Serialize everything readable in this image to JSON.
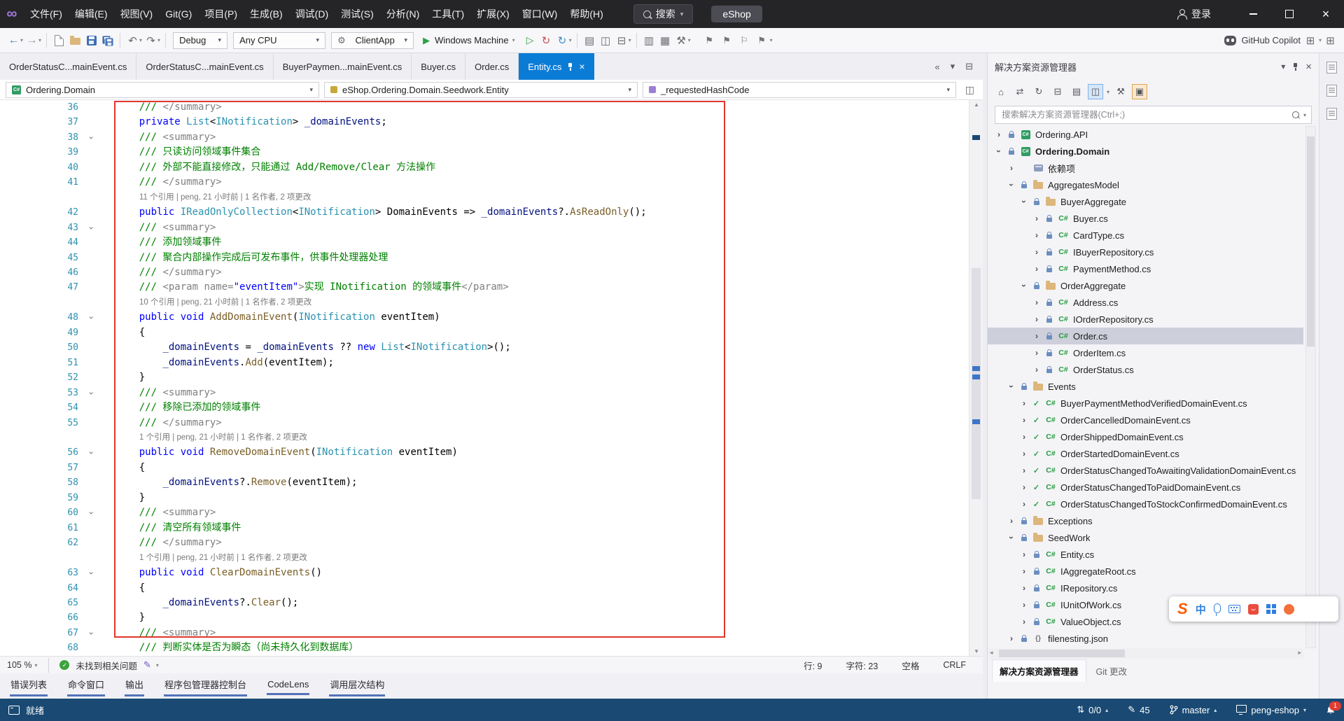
{
  "titlebar": {
    "menus": [
      "文件(F)",
      "编辑(E)",
      "视图(V)",
      "Git(G)",
      "项目(P)",
      "生成(B)",
      "调试(D)",
      "测试(S)",
      "分析(N)",
      "工具(T)",
      "扩展(X)",
      "窗口(W)",
      "帮助(H)"
    ],
    "search_label": "搜索",
    "solution_badge": "eShop",
    "signin_label": "登录"
  },
  "toolbar": {
    "debug_config": "Debug",
    "platform": "Any CPU",
    "startup_profile": "ClientApp",
    "run_target": "Windows Machine",
    "copilot_label": "GitHub Copilot"
  },
  "tabs": [
    {
      "label": "OrderStatusC...mainEvent.cs",
      "active": false
    },
    {
      "label": "OrderStatusC...mainEvent.cs",
      "active": false
    },
    {
      "label": "BuyerPaymen...mainEvent.cs",
      "active": false
    },
    {
      "label": "Buyer.cs",
      "active": false
    },
    {
      "label": "Order.cs",
      "active": false
    },
    {
      "label": "Entity.cs",
      "active": true
    }
  ],
  "navbar": {
    "project": "Ordering.Domain",
    "type": "eShop.Ordering.Domain.Seedwork.Entity",
    "member": "_requestedHashCode"
  },
  "editor": {
    "lines": [
      {
        "n": "36",
        "t": [
          [
            "p",
            "    "
          ],
          [
            "c",
            "/// "
          ],
          [
            "g",
            "</summary>"
          ]
        ]
      },
      {
        "n": "37",
        "t": [
          [
            "p",
            "    "
          ],
          [
            "k",
            "private"
          ],
          [
            "p",
            " "
          ],
          [
            "t",
            "List"
          ],
          [
            "p",
            "<"
          ],
          [
            "t",
            "INotification"
          ],
          [
            "p",
            "> "
          ],
          [
            "f",
            "_domainEvents"
          ],
          [
            "p",
            ";"
          ]
        ]
      },
      {
        "n": "38",
        "fold": true,
        "t": [
          [
            "p",
            "    "
          ],
          [
            "c",
            "/// "
          ],
          [
            "g",
            "<summary>"
          ]
        ]
      },
      {
        "n": "39",
        "t": [
          [
            "p",
            "    "
          ],
          [
            "c",
            "/// 只读访问领域事件集合"
          ]
        ]
      },
      {
        "n": "40",
        "t": [
          [
            "p",
            "    "
          ],
          [
            "c",
            "/// 外部不能直接修改，只能通过 Add/Remove/Clear 方法操作"
          ]
        ]
      },
      {
        "n": "41",
        "t": [
          [
            "p",
            "    "
          ],
          [
            "c",
            "/// "
          ],
          [
            "g",
            "</summary>"
          ]
        ]
      },
      {
        "cl": "11 个引用 | peng, 21 小时前 | 1 名作者, 2 项更改"
      },
      {
        "n": "42",
        "t": [
          [
            "p",
            "    "
          ],
          [
            "k",
            "public"
          ],
          [
            "p",
            " "
          ],
          [
            "t",
            "IReadOnlyCollection"
          ],
          [
            "p",
            "<"
          ],
          [
            "t",
            "INotification"
          ],
          [
            "p",
            "> DomainEvents => "
          ],
          [
            "f",
            "_domainEvents"
          ],
          [
            "p",
            "?."
          ],
          [
            "m",
            "AsReadOnly"
          ],
          [
            "p",
            "();"
          ]
        ]
      },
      {
        "n": "43",
        "fold": true,
        "t": [
          [
            "p",
            "    "
          ],
          [
            "c",
            "/// "
          ],
          [
            "g",
            "<summary>"
          ]
        ]
      },
      {
        "n": "44",
        "t": [
          [
            "p",
            "    "
          ],
          [
            "c",
            "/// 添加领域事件"
          ]
        ]
      },
      {
        "n": "45",
        "t": [
          [
            "p",
            "    "
          ],
          [
            "c",
            "/// 聚合内部操作完成后可发布事件，供事件处理器处理"
          ]
        ]
      },
      {
        "n": "46",
        "t": [
          [
            "p",
            "    "
          ],
          [
            "c",
            "/// "
          ],
          [
            "g",
            "</summary>"
          ]
        ]
      },
      {
        "n": "47",
        "t": [
          [
            "p",
            "    "
          ],
          [
            "c",
            "/// "
          ],
          [
            "g",
            "<param name="
          ],
          [
            "a",
            "\"eventItem\""
          ],
          [
            "g",
            ">"
          ],
          [
            "c",
            "实现 INotification 的领域事件"
          ],
          [
            "g",
            "</param>"
          ]
        ]
      },
      {
        "cl": "10 个引用 | peng, 21 小时前 | 1 名作者, 2 项更改"
      },
      {
        "n": "48",
        "fold": true,
        "t": [
          [
            "p",
            "    "
          ],
          [
            "k",
            "public"
          ],
          [
            "p",
            " "
          ],
          [
            "k",
            "void"
          ],
          [
            "p",
            " "
          ],
          [
            "m",
            "AddDomainEvent"
          ],
          [
            "p",
            "("
          ],
          [
            "t",
            "INotification"
          ],
          [
            "p",
            " eventItem)"
          ]
        ]
      },
      {
        "n": "49",
        "t": [
          [
            "p",
            "    {"
          ]
        ]
      },
      {
        "n": "50",
        "t": [
          [
            "p",
            "        "
          ],
          [
            "f",
            "_domainEvents"
          ],
          [
            "p",
            " = "
          ],
          [
            "f",
            "_domainEvents"
          ],
          [
            "p",
            " ?? "
          ],
          [
            "k",
            "new"
          ],
          [
            "p",
            " "
          ],
          [
            "t",
            "List"
          ],
          [
            "p",
            "<"
          ],
          [
            "t",
            "INotification"
          ],
          [
            "p",
            ">();"
          ]
        ]
      },
      {
        "n": "51",
        "t": [
          [
            "p",
            "        "
          ],
          [
            "f",
            "_domainEvents"
          ],
          [
            "p",
            "."
          ],
          [
            "m",
            "Add"
          ],
          [
            "p",
            "(eventItem);"
          ]
        ]
      },
      {
        "n": "52",
        "t": [
          [
            "p",
            "    }"
          ]
        ]
      },
      {
        "n": "53",
        "fold": true,
        "t": [
          [
            "p",
            "    "
          ],
          [
            "c",
            "/// "
          ],
          [
            "g",
            "<summary>"
          ]
        ]
      },
      {
        "n": "54",
        "t": [
          [
            "p",
            "    "
          ],
          [
            "c",
            "/// 移除已添加的领域事件"
          ]
        ]
      },
      {
        "n": "55",
        "t": [
          [
            "p",
            "    "
          ],
          [
            "c",
            "/// "
          ],
          [
            "g",
            "</summary>"
          ]
        ]
      },
      {
        "cl": "1 个引用 | peng, 21 小时前 | 1 名作者, 2 项更改"
      },
      {
        "n": "56",
        "fold": true,
        "t": [
          [
            "p",
            "    "
          ],
          [
            "k",
            "public"
          ],
          [
            "p",
            " "
          ],
          [
            "k",
            "void"
          ],
          [
            "p",
            " "
          ],
          [
            "m",
            "RemoveDomainEvent"
          ],
          [
            "p",
            "("
          ],
          [
            "t",
            "INotification"
          ],
          [
            "p",
            " eventItem)"
          ]
        ]
      },
      {
        "n": "57",
        "t": [
          [
            "p",
            "    {"
          ]
        ]
      },
      {
        "n": "58",
        "t": [
          [
            "p",
            "        "
          ],
          [
            "f",
            "_domainEvents"
          ],
          [
            "p",
            "?."
          ],
          [
            "m",
            "Remove"
          ],
          [
            "p",
            "(eventItem);"
          ]
        ]
      },
      {
        "n": "59",
        "t": [
          [
            "p",
            "    }"
          ]
        ]
      },
      {
        "n": "60",
        "fold": true,
        "t": [
          [
            "p",
            "    "
          ],
          [
            "c",
            "/// "
          ],
          [
            "g",
            "<summary>"
          ]
        ]
      },
      {
        "n": "61",
        "t": [
          [
            "p",
            "    "
          ],
          [
            "c",
            "/// 清空所有领域事件"
          ]
        ]
      },
      {
        "n": "62",
        "t": [
          [
            "p",
            "    "
          ],
          [
            "c",
            "/// "
          ],
          [
            "g",
            "</summary>"
          ]
        ]
      },
      {
        "cl": "1 个引用 | peng, 21 小时前 | 1 名作者, 2 项更改"
      },
      {
        "n": "63",
        "fold": true,
        "t": [
          [
            "p",
            "    "
          ],
          [
            "k",
            "public"
          ],
          [
            "p",
            " "
          ],
          [
            "k",
            "void"
          ],
          [
            "p",
            " "
          ],
          [
            "m",
            "ClearDomainEvents"
          ],
          [
            "p",
            "()"
          ]
        ]
      },
      {
        "n": "64",
        "t": [
          [
            "p",
            "    {"
          ]
        ]
      },
      {
        "n": "65",
        "t": [
          [
            "p",
            "        "
          ],
          [
            "f",
            "_domainEvents"
          ],
          [
            "p",
            "?."
          ],
          [
            "m",
            "Clear"
          ],
          [
            "p",
            "();"
          ]
        ]
      },
      {
        "n": "66",
        "t": [
          [
            "p",
            "    }"
          ]
        ]
      },
      {
        "n": "67",
        "fold": true,
        "t": [
          [
            "p",
            "    "
          ],
          [
            "c",
            "/// "
          ],
          [
            "g",
            "<summary>"
          ]
        ]
      },
      {
        "n": "68",
        "t": [
          [
            "p",
            "    "
          ],
          [
            "c",
            "/// 判断实体是否为瞬态（尚未持久化到数据库）"
          ]
        ]
      }
    ]
  },
  "editor_status": {
    "zoom": "105 %",
    "problems": "未找到相关问题",
    "line_label": "行: 9",
    "char_label": "字符: 23",
    "spaces_label": "空格",
    "eol_label": "CRLF"
  },
  "panel_tabs": [
    "错误列表",
    "命令窗口",
    "输出",
    "程序包管理器控制台",
    "CodeLens",
    "调用层次结构"
  ],
  "solution_explorer": {
    "title": "解决方案资源管理器",
    "search_placeholder": "搜索解决方案资源管理器(Ctrl+;)",
    "tabs": [
      "解决方案资源管理器",
      "Git 更改"
    ],
    "tree": [
      {
        "lvl": 0,
        "arrow": "c",
        "icon": "project",
        "badge": "lock",
        "label": "Ordering.API"
      },
      {
        "lvl": 0,
        "arrow": "e",
        "icon": "project",
        "badge": "lock",
        "label": "Ordering.Domain",
        "bold": true
      },
      {
        "lvl": 1,
        "arrow": "c",
        "icon": "deps",
        "badge": "none",
        "label": "依赖项"
      },
      {
        "lvl": 1,
        "arrow": "e",
        "icon": "folder",
        "badge": "lock",
        "label": "AggregatesModel"
      },
      {
        "lvl": 2,
        "arrow": "e",
        "icon": "folder",
        "badge": "lock",
        "label": "BuyerAggregate"
      },
      {
        "lvl": 3,
        "arrow": "c",
        "icon": "cs",
        "badge": "lock",
        "label": "Buyer.cs"
      },
      {
        "lvl": 3,
        "arrow": "c",
        "icon": "cs",
        "badge": "lock",
        "label": "CardType.cs"
      },
      {
        "lvl": 3,
        "arrow": "c",
        "icon": "cs",
        "badge": "lock",
        "label": "IBuyerRepository.cs"
      },
      {
        "lvl": 3,
        "arrow": "c",
        "icon": "cs",
        "badge": "lock",
        "label": "PaymentMethod.cs"
      },
      {
        "lvl": 2,
        "arrow": "e",
        "icon": "folder",
        "badge": "lock",
        "label": "OrderAggregate"
      },
      {
        "lvl": 3,
        "arrow": "c",
        "icon": "cs",
        "badge": "lock",
        "label": "Address.cs"
      },
      {
        "lvl": 3,
        "arrow": "c",
        "icon": "cs",
        "badge": "lock",
        "label": "IOrderRepository.cs"
      },
      {
        "lvl": 3,
        "arrow": "c",
        "icon": "cs",
        "badge": "lock",
        "label": "Order.cs",
        "selected": true
      },
      {
        "lvl": 3,
        "arrow": "c",
        "icon": "cs",
        "badge": "lock",
        "label": "OrderItem.cs"
      },
      {
        "lvl": 3,
        "arrow": "c",
        "icon": "cs",
        "badge": "lock",
        "label": "OrderStatus.cs"
      },
      {
        "lvl": 1,
        "arrow": "e",
        "icon": "folder",
        "badge": "lock",
        "label": "Events"
      },
      {
        "lvl": 2,
        "arrow": "c",
        "icon": "cs",
        "badge": "check",
        "label": "BuyerPaymentMethodVerifiedDomainEvent.cs"
      },
      {
        "lvl": 2,
        "arrow": "c",
        "icon": "cs",
        "badge": "check",
        "label": "OrderCancelledDomainEvent.cs"
      },
      {
        "lvl": 2,
        "arrow": "c",
        "icon": "cs",
        "badge": "check",
        "label": "OrderShippedDomainEvent.cs"
      },
      {
        "lvl": 2,
        "arrow": "c",
        "icon": "cs",
        "badge": "check",
        "label": "OrderStartedDomainEvent.cs"
      },
      {
        "lvl": 2,
        "arrow": "c",
        "icon": "cs",
        "badge": "check",
        "label": "OrderStatusChangedToAwaitingValidationDomainEvent.cs"
      },
      {
        "lvl": 2,
        "arrow": "c",
        "icon": "cs",
        "badge": "check",
        "label": "OrderStatusChangedToPaidDomainEvent.cs"
      },
      {
        "lvl": 2,
        "arrow": "c",
        "icon": "cs",
        "badge": "check",
        "label": "OrderStatusChangedToStockConfirmedDomainEvent.cs"
      },
      {
        "lvl": 1,
        "arrow": "c",
        "icon": "folder",
        "badge": "lock",
        "label": "Exceptions"
      },
      {
        "lvl": 1,
        "arrow": "e",
        "icon": "folder",
        "badge": "lock",
        "label": "SeedWork"
      },
      {
        "lvl": 2,
        "arrow": "c",
        "icon": "cs",
        "badge": "lock",
        "label": "Entity.cs"
      },
      {
        "lvl": 2,
        "arrow": "c",
        "icon": "cs",
        "badge": "lock",
        "label": "IAggregateRoot.cs"
      },
      {
        "lvl": 2,
        "arrow": "c",
        "icon": "cs",
        "badge": "lock",
        "label": "IRepository.cs"
      },
      {
        "lvl": 2,
        "arrow": "c",
        "icon": "cs",
        "badge": "lock",
        "label": "IUnitOfWork.cs"
      },
      {
        "lvl": 2,
        "arrow": "c",
        "icon": "cs",
        "badge": "lock",
        "label": "ValueObject.cs"
      },
      {
        "lvl": 1,
        "arrow": "c",
        "icon": "json",
        "badge": "lock",
        "label": "filenesting.json"
      }
    ]
  },
  "statusbar": {
    "ready": "就绪",
    "sync": "0/0",
    "edits": "45",
    "branch": "master",
    "repo": "peng-eshop",
    "notif": "1"
  },
  "ime": {
    "logo": "S",
    "lang": "中"
  }
}
